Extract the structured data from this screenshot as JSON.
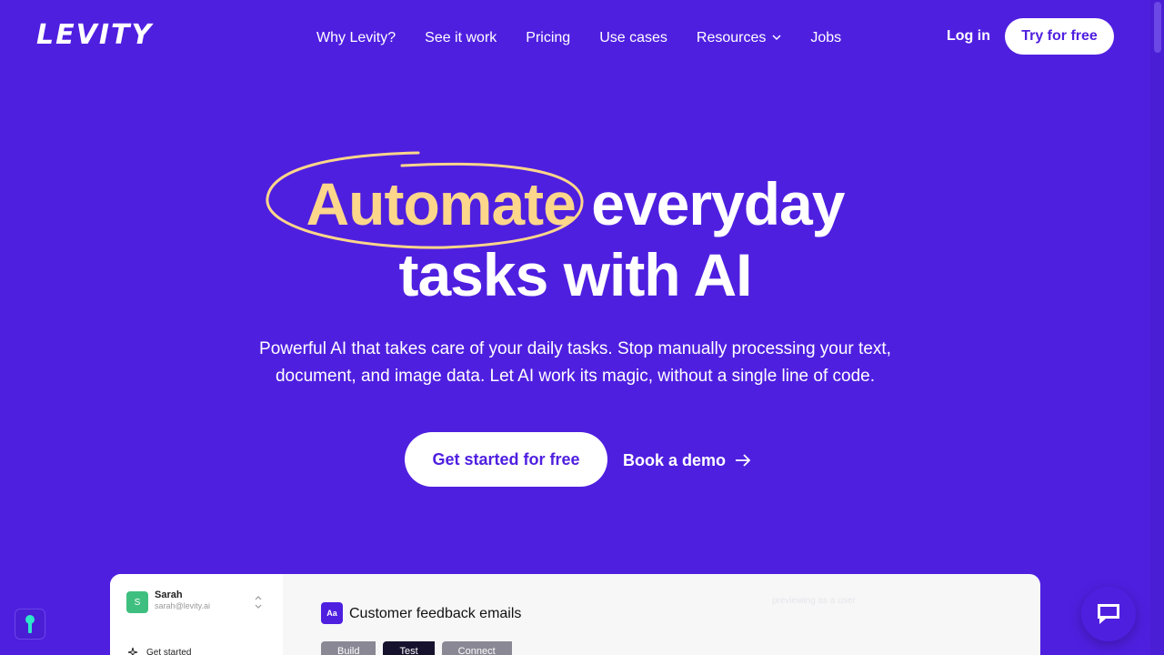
{
  "brand": {
    "logo_text": "LEVITY"
  },
  "nav": {
    "items": [
      {
        "label": "Why Levity?"
      },
      {
        "label": "See it work"
      },
      {
        "label": "Pricing"
      },
      {
        "label": "Use cases"
      },
      {
        "label": "Resources",
        "has_dropdown": true
      },
      {
        "label": "Jobs"
      }
    ],
    "login": "Log in",
    "try_free": "Try for free"
  },
  "hero": {
    "highlight": "Automate",
    "line1_rest": "everyday",
    "line2": "tasks with AI",
    "subtitle": "Powerful AI that takes care of your daily tasks. Stop manually processing your text, document, and image data. Let AI work its magic, without a single line of code.",
    "cta_primary": "Get started for free",
    "cta_secondary": "Book a demo"
  },
  "preview": {
    "user_name": "Sarah",
    "user_email": "sarah@levity.ai",
    "user_initial": "S",
    "get_started": "Get started",
    "workflow_icon": "Aa",
    "workflow_title": "Customer feedback emails",
    "watermark": "previewing as a user",
    "steps": [
      "Build",
      "Test",
      "Connect"
    ]
  },
  "colors": {
    "background": "#4F1FE0",
    "highlight": "#FCD68A",
    "white": "#FFFFFF"
  },
  "icons": {
    "resources_dropdown": "chevron-down-icon",
    "demo_arrow": "arrow-right-icon",
    "key": "key-icon",
    "chat": "chat-bubble-icon"
  }
}
